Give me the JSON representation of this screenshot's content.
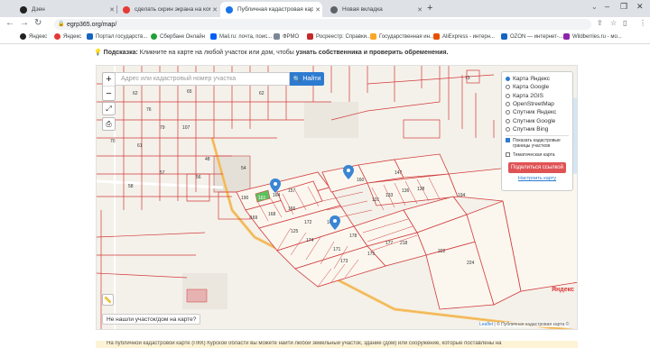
{
  "tabs": [
    {
      "label": "Дзен",
      "favicon_color": "#222222"
    },
    {
      "label": "сделать скрин экрана на комп...",
      "favicon_color": "#e53935"
    },
    {
      "label": "Публичная кадастровая карта Р...",
      "favicon_color": "#1a73e8",
      "active": true
    },
    {
      "label": "Новая вкладка",
      "favicon_color": "#5f6368"
    }
  ],
  "address": {
    "url": "egrp365.org/map/"
  },
  "bookmarks": [
    {
      "label": "Яндекс",
      "color": "#222222"
    },
    {
      "label": "Яндекс",
      "color": "#e53935"
    },
    {
      "label": "Портал государств...",
      "color": "#1565c0"
    },
    {
      "label": "Сбербанк Онлайн",
      "color": "#21a038"
    },
    {
      "label": "Mail.ru: почта, поис...",
      "color": "#005ff9"
    },
    {
      "label": "ФРМО",
      "color": "#7b8794"
    },
    {
      "label": "Росреестр: Справки...",
      "color": "#c62828"
    },
    {
      "label": "Государственная ин...",
      "color": "#f9a825"
    },
    {
      "label": "AliExpress - интерн...",
      "color": "#e65100"
    },
    {
      "label": "OZON — интернет-...",
      "color": "#1565c0"
    },
    {
      "label": "Wildberries.ru - мо...",
      "color": "#8e24aa"
    }
  ],
  "hint": {
    "prefix": "Подсказка:",
    "text": "Кликните на карте на любой участок или дом, чтобы",
    "bold": "узнать собственника и проверить обременения."
  },
  "map": {
    "search_placeholder": "Адрес или кадастровый номер участка",
    "search_button": "Найти",
    "zoom_in": "+",
    "zoom_out": "−",
    "layers": [
      {
        "label": "Карта Яндекс",
        "selected": true
      },
      {
        "label": "Карта Google",
        "selected": false
      },
      {
        "label": "Карта 2GIS",
        "selected": false
      },
      {
        "label": "OpenStreetMap",
        "selected": false
      },
      {
        "label": "Спутник Яндекс",
        "selected": false
      },
      {
        "label": "Спутник Google",
        "selected": false
      },
      {
        "label": "Спутник Bing",
        "selected": false
      }
    ],
    "overlay_cadastral": "Показать кадастровые границы участков",
    "overlay_thematic": "Тематическая карта",
    "share_button": "Поделиться ссылкой",
    "setup_link": "Настроить карту",
    "not_found": "Не нашли участок/дом на карте?",
    "logo": "Яндекс",
    "attribution_leaflet": "Leaflet",
    "attribution_rest": "| © Публичная кадастровая карта ©",
    "parcel_labels": [
      "54",
      "190",
      "161",
      "164",
      "157",
      "160",
      "147",
      "194",
      "169",
      "168",
      "166",
      "174",
      "165",
      "178",
      "171",
      "173",
      "175",
      "177",
      "218",
      "222",
      "224",
      "125",
      "172",
      "131",
      "133",
      "136",
      "138",
      "62",
      "76",
      "107",
      "79",
      "61",
      "69",
      "70",
      "62",
      "65",
      "73",
      "58",
      "57",
      "56",
      "48"
    ]
  },
  "footer": {
    "text": "На публичной кадастровой карте (ПКК) Курской области вы можете найти любой земельный участок, здание (дом) или сооружение, которые поставлены на"
  }
}
